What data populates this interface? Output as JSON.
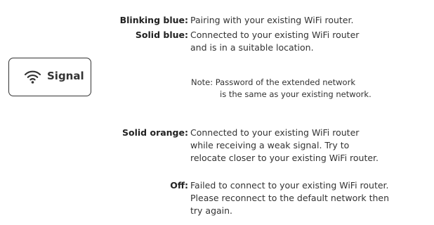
{
  "indicator": {
    "icon": "wifi-icon",
    "label": "Signal"
  },
  "states": [
    {
      "term": "Blinking blue:",
      "lines": [
        "Pairing with your existing WiFi router."
      ]
    },
    {
      "term": "Solid blue:",
      "lines": [
        "Connected to your existing WiFi router",
        "and is in a suitable location."
      ]
    },
    {
      "term": "Solid orange:",
      "lines": [
        "Connected to your existing WiFi router",
        "while receiving a weak signal. Try to",
        "relocate closer to your existing WiFi router."
      ]
    },
    {
      "term": "Off:",
      "lines": [
        "Failed to connect to your existing WiFi router.",
        "Please reconnect to the default network then",
        "try again."
      ]
    }
  ],
  "note": {
    "line1": "Note: Password of the extended network",
    "line2": "is the same as your existing network."
  }
}
